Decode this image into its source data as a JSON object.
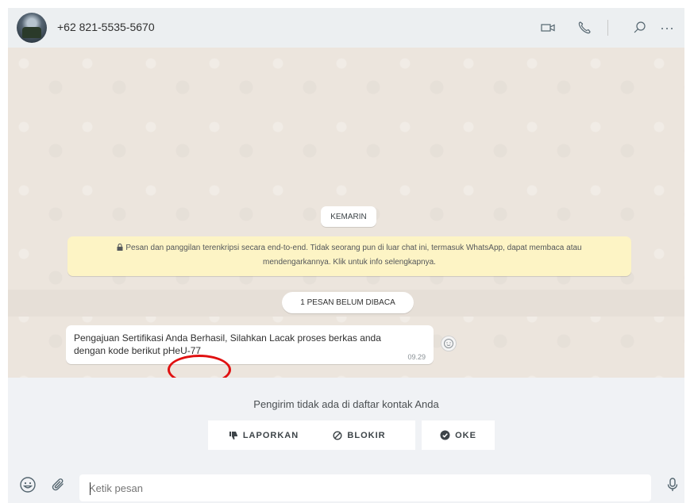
{
  "header": {
    "contact_name": "+62 821-5535-5670",
    "icons": [
      "video-call-icon",
      "voice-call-icon",
      "search-icon",
      "menu-icon"
    ]
  },
  "chat": {
    "date_chip": "KEMARIN",
    "encryption_notice": "Pesan dan panggilan terenkripsi secara end-to-end. Tidak seorang pun di luar chat ini, termasuk WhatsApp, dapat membaca atau mendengarkannya. Klik untuk info selengkapnya.",
    "unread_chip": "1 PESAN BELUM DIBACA",
    "message": {
      "text": "Pengajuan Sertifikasi Anda Berhasil, Silahkan Lacak proses berkas anda dengan kode berikut pHeU-77",
      "time": "09.29"
    }
  },
  "unknown_sender": {
    "notice": "Pengirim tidak ada di daftar kontak Anda",
    "report_label": "LAPORKAN",
    "block_label": "BLOKIR",
    "ok_label": "OKE"
  },
  "compose": {
    "placeholder": "Ketik pesan"
  },
  "colors": {
    "header_bg": "#eceff1",
    "chat_bg": "#ece5dd",
    "notice_bg": "#fdf4c5",
    "annotation_red": "#e01010"
  }
}
